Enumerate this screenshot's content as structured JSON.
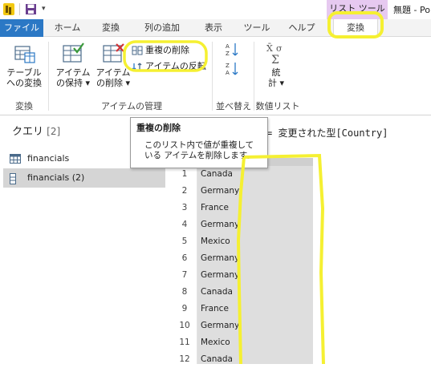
{
  "title_bar": {
    "context_tab": "リスト ツール",
    "window_title": "無題 - Po"
  },
  "tabs": [
    {
      "label": "ファイル"
    },
    {
      "label": "ホーム"
    },
    {
      "label": "変換"
    },
    {
      "label": "列の追加"
    },
    {
      "label": "表示"
    },
    {
      "label": "ツール"
    },
    {
      "label": "ヘルプ"
    },
    {
      "label": "変換"
    }
  ],
  "ribbon": {
    "convert_group": {
      "table_button_line1": "テーブル",
      "table_button_line2": "への変換",
      "label": "変換"
    },
    "items_group": {
      "keep_button_line1": "アイテム",
      "keep_button_line2": "の保持",
      "remove_button_line1": "アイテム",
      "remove_button_line2": "の削除",
      "remove_duplicates": "重複の削除",
      "reverse_items": "アイテムの反転",
      "label": "アイテムの管理"
    },
    "sort_group": {
      "label": "並べ替え"
    },
    "numeric_group": {
      "stats_line1": "統",
      "stats_line2": "計",
      "label": "数値リスト"
    }
  },
  "queries": {
    "title": "クエリ",
    "count": "[2]",
    "items": [
      {
        "label": "financials"
      },
      {
        "label": "financials (2)"
      }
    ]
  },
  "formula": "= 変更された型[Country]",
  "tooltip": {
    "title": "重複の削除",
    "body": "このリスト内で値が重複している アイテムを削除します。"
  },
  "grid": {
    "rows": [
      {
        "n": "1",
        "value": "Canada"
      },
      {
        "n": "2",
        "value": "Germany"
      },
      {
        "n": "3",
        "value": "France"
      },
      {
        "n": "4",
        "value": "Germany"
      },
      {
        "n": "5",
        "value": "Mexico"
      },
      {
        "n": "6",
        "value": "Germany"
      },
      {
        "n": "7",
        "value": "Germany"
      },
      {
        "n": "8",
        "value": "Canada"
      },
      {
        "n": "9",
        "value": "France"
      },
      {
        "n": "10",
        "value": "Germany"
      },
      {
        "n": "11",
        "value": "Mexico"
      },
      {
        "n": "12",
        "value": "Canada"
      }
    ]
  },
  "colors": {
    "accent": "#2b78c5",
    "context_tab": "#e6c9f0",
    "highlight": "#f5f032",
    "selected_query": "#d5d5d5"
  }
}
